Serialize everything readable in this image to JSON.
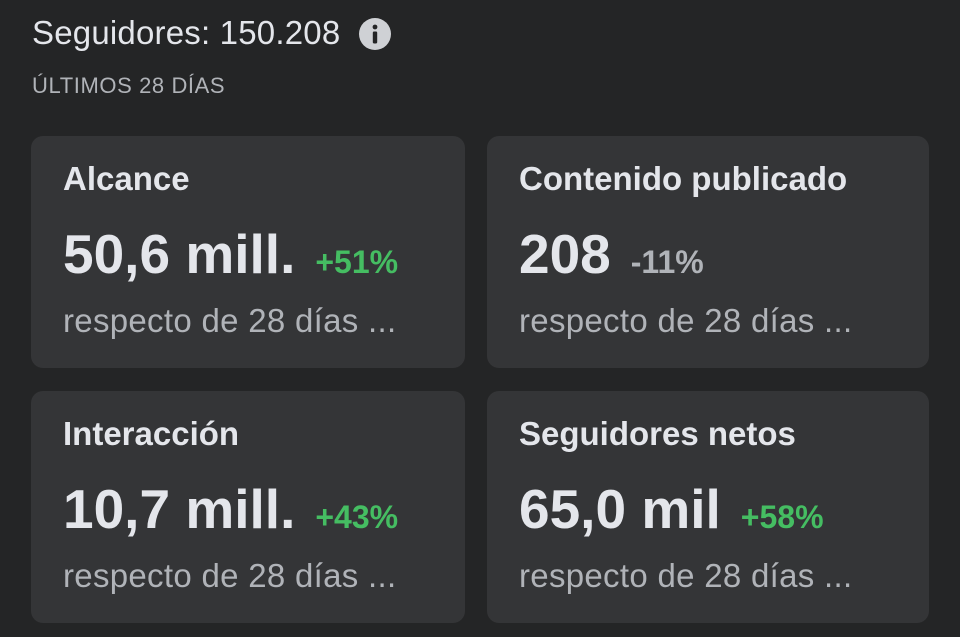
{
  "header": {
    "followers_title": "Seguidores: 150.208",
    "period": "ÚLTIMOS 28 DÍAS",
    "info_icon": "info-circle-icon"
  },
  "colors": {
    "background": "#242526",
    "card": "#343537",
    "positive": "#45bd62",
    "neutral": "#b0b3b8"
  },
  "metrics": [
    {
      "title": "Alcance",
      "value": "50,6 mill.",
      "change": "+51%",
      "trend": "positive",
      "compare": "respecto de 28 días ..."
    },
    {
      "title": "Contenido publicado",
      "value": "208",
      "change": "-11%",
      "trend": "negative",
      "compare": "respecto de 28 días ..."
    },
    {
      "title": "Interacción",
      "value": "10,7 mill.",
      "change": "+43%",
      "trend": "positive",
      "compare": "respecto de 28 días ..."
    },
    {
      "title": "Seguidores netos",
      "value": "65,0 mil",
      "change": "+58%",
      "trend": "positive",
      "compare": "respecto de 28 días ..."
    }
  ]
}
